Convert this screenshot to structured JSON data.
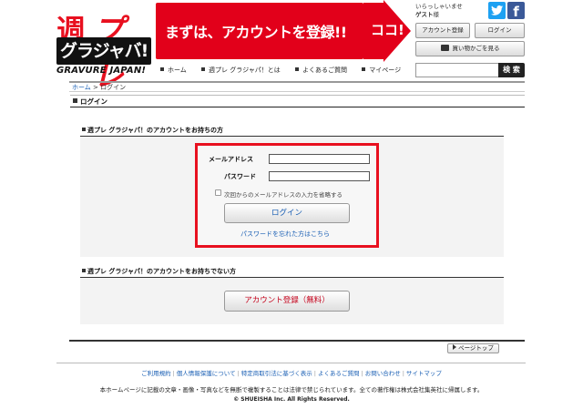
{
  "brand": {
    "logo_line1_a": "週",
    "logo_line1_b": "プレ",
    "logo_line2": "グラジャバ!",
    "logo_line3": "GRAVURE JAPAN!",
    "accent": "#e2001a"
  },
  "banner": {
    "text": "まずは、アカウントを登録!!",
    "arrow_text": "ココ!"
  },
  "nav": {
    "items": [
      {
        "label": "ホーム"
      },
      {
        "label": "週プレ グラジャパ！とは"
      },
      {
        "label": "よくあるご質問"
      },
      {
        "label": "マイページ"
      }
    ]
  },
  "account_area": {
    "greeting": "いらっしゃいませ",
    "user": "ゲスト",
    "honorific": "様",
    "register_label": "アカウント登録",
    "login_label": "ログイン",
    "cart_label": "買い物かごを見る",
    "search_placeholder": "",
    "search_label": "検 索",
    "twitter_icon": "twitter-icon",
    "facebook_icon": "facebook-icon",
    "facebook_glyph": "f"
  },
  "breadcrumb": {
    "home": "ホーム",
    "separator": ">",
    "current": "ログイン"
  },
  "page_title": "ログイン",
  "login_section": {
    "heading": "週プレ グラジャパ！のアカウントをお持ちの方",
    "email_label": "メールアドレス",
    "email_value": "",
    "password_label": "パスワード",
    "password_value": "",
    "remember_label": "次回からのメールアドレスの入力を省略する",
    "login_button": "ログイン",
    "forgot_link": "パスワードを忘れた方はこちら"
  },
  "register_section": {
    "heading": "週プレ グラジャパ！のアカウントをお持ちでない方",
    "register_button": "アカウント登録（無料）"
  },
  "footer": {
    "page_top": "ページトップ",
    "links": [
      {
        "label": "ご利用規約"
      },
      {
        "label": "個人情報保護について"
      },
      {
        "label": "特定商取引法に基づく表示"
      },
      {
        "label": "よくあるご質問"
      },
      {
        "label": "お問い合わせ"
      },
      {
        "label": "サイトマップ"
      }
    ],
    "link_separator": "|",
    "notice": "本ホームページに記載の文章・画像・写真などを無断で複製することは法律で禁じられています。全ての著作権は株式会社集英社に帰属します。",
    "copyright": "© SHUEISHA Inc. All Rights Reserved."
  }
}
